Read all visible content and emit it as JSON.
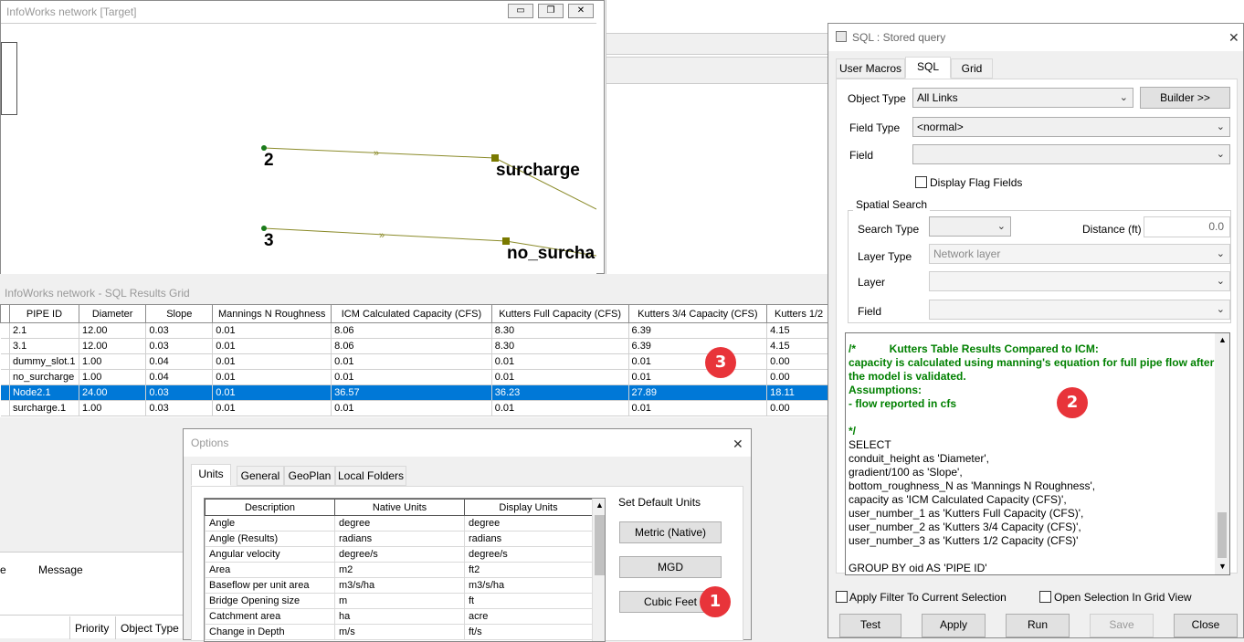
{
  "network_window": {
    "title": "InfoWorks network [Target]",
    "min": "▭",
    "restore": "❐",
    "close": "✕",
    "labels": {
      "node2": "2",
      "node3": "3",
      "surcharge": "surcharge",
      "no_surcharge": "no_surcha"
    }
  },
  "results_grid": {
    "title": "InfoWorks network - SQL Results Grid",
    "columns": [
      "PIPE ID",
      "Diameter",
      "Slope",
      "Mannings N Roughness",
      "ICM Calculated Capacity (CFS)",
      "Kutters Full Capacity (CFS)",
      "Kutters 3/4 Capacity (CFS)",
      "Kutters 1/2"
    ],
    "rows": [
      [
        "2.1",
        "12.00",
        "0.03",
        "0.01",
        "8.06",
        "8.30",
        "6.39",
        "4.15"
      ],
      [
        "3.1",
        "12.00",
        "0.03",
        "0.01",
        "8.06",
        "8.30",
        "6.39",
        "4.15"
      ],
      [
        "dummy_slot.1",
        "1.00",
        "0.04",
        "0.01",
        "0.01",
        "0.01",
        "0.01",
        "0.00"
      ],
      [
        "no_surcharge",
        "1.00",
        "0.04",
        "0.01",
        "0.01",
        "0.01",
        "0.01",
        "0.00"
      ],
      [
        "Node2.1",
        "24.00",
        "0.03",
        "0.01",
        "36.57",
        "36.23",
        "27.89",
        "18.11"
      ],
      [
        "surcharge.1",
        "1.00",
        "0.03",
        "0.01",
        "0.01",
        "0.01",
        "0.01",
        "0.00"
      ]
    ],
    "selected_row": 4
  },
  "message_panel": {
    "col_e": "e",
    "message": "Message",
    "priority": "Priority",
    "object_type": "Object Type"
  },
  "sql_dialog": {
    "title": "SQL : Stored query",
    "close": "✕",
    "tabs": [
      "User Macros",
      "SQL",
      "Grid"
    ],
    "active_tab": 1,
    "object_type_label": "Object Type",
    "object_type_value": "All Links",
    "builder": "Builder >>",
    "field_type_label": "Field Type",
    "field_type_value": "<normal>",
    "field_label": "Field",
    "field_value": "",
    "display_flag_fields": "Display Flag Fields",
    "spatial": {
      "group": "Spatial Search",
      "search_type": "Search Type",
      "distance_label": "Distance (ft)",
      "distance_value": "0.0",
      "layer_type": "Layer Type",
      "layer_type_value": "Network layer",
      "layer": "Layer",
      "field": "Field"
    },
    "code_comment": [
      "/*           Kutters Table Results Compared to ICM:",
      "capacity is calculated using manning's equation for full pipe flow after",
      "the model is validated.",
      "Assumptions:",
      "- flow reported in cfs",
      "",
      "*/"
    ],
    "code_sql": [
      "SELECT",
      "conduit_height as 'Diameter',",
      "gradient/100 as 'Slope',",
      "bottom_roughness_N as 'Mannings N Roughness',",
      "capacity as 'ICM Calculated Capacity (CFS)',",
      "user_number_1 as 'Kutters Full Capacity (CFS)',",
      "user_number_2 as 'Kutters 3/4 Capacity (CFS)',",
      "user_number_3 as 'Kutters 1/2 Capacity (CFS)'",
      "",
      "GROUP BY oid AS 'PIPE ID'"
    ],
    "apply_filter": "Apply Filter To Current Selection",
    "open_selection": "Open Selection In Grid View",
    "buttons": {
      "test": "Test",
      "apply": "Apply",
      "run": "Run",
      "save": "Save",
      "close": "Close"
    }
  },
  "options_dialog": {
    "title": "Options",
    "close": "✕",
    "tabs": [
      "Units",
      "General",
      "GeoPlan",
      "Local Folders"
    ],
    "active_tab": 0,
    "columns": [
      "Description",
      "Native Units",
      "Display Units"
    ],
    "rows": [
      [
        "Angle",
        "degree",
        "degree"
      ],
      [
        "Angle (Results)",
        "radians",
        "radians"
      ],
      [
        "Angular velocity",
        "degree/s",
        "degree/s"
      ],
      [
        "Area",
        "m2",
        "ft2"
      ],
      [
        "Baseflow per unit area",
        "m3/s/ha",
        "m3/s/ha"
      ],
      [
        "Bridge Opening size",
        "m",
        "ft"
      ],
      [
        "Catchment area",
        "ha",
        "acre"
      ],
      [
        "Change in Depth",
        "m/s",
        "ft/s"
      ]
    ],
    "set_default": "Set Default Units",
    "metric": "Metric (Native)",
    "mgd": "MGD",
    "cubic_feet": "Cubic Feet"
  },
  "badges": {
    "b1": "1",
    "b2": "2",
    "b3": "3"
  },
  "colors": {
    "selection": "#0078d7",
    "badge": "#e8343a",
    "link": "#8b8b2a",
    "comment": "#008000"
  }
}
